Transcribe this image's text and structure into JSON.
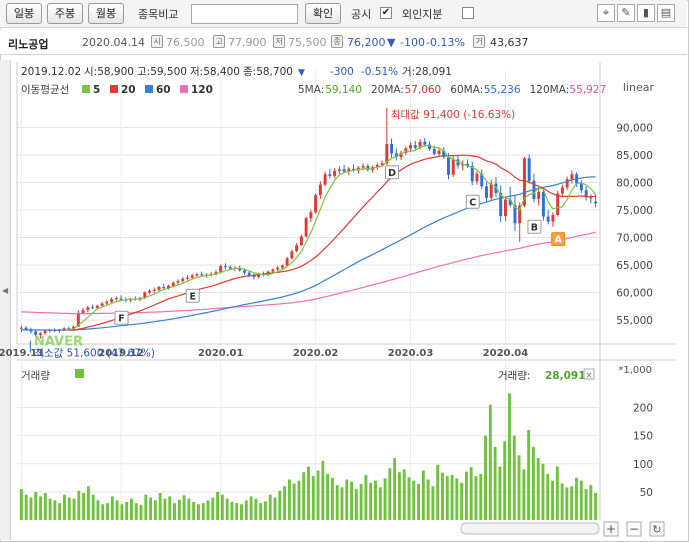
{
  "toolbar": {
    "tab_daily": "일봉",
    "tab_weekly": "주봉",
    "tab_monthly": "월봉",
    "compare_label": "종목비교",
    "compare_value": "",
    "confirm_label": "확인",
    "disclosure_label": "공시",
    "disclosure_checked": "✔",
    "foreign_label": "외인지분",
    "foreign_checked": ""
  },
  "info": {
    "name": "리노공업",
    "date": "2020.04.14",
    "open": "76,500",
    "high": "77,900",
    "low": "75,500",
    "close": "76,200",
    "change": "-100",
    "change_pct": "-0.13%",
    "volume": "43,637",
    "icons": {
      "open": "시",
      "high": "고",
      "low": "저",
      "close": "종",
      "volume": "거"
    }
  },
  "ohlc_readout": {
    "date": "2019.12.02",
    "text_open": "시:58,900",
    "text_high": "고:59,500",
    "text_low": "저:58,400",
    "text_close": "종:58,700",
    "change": "-300",
    "change_pct": "-0.51%",
    "volume": "거:28,091"
  },
  "legend": {
    "title": "이동평균선",
    "items": [
      {
        "label": "5",
        "color": "#7cc442"
      },
      {
        "label": "20",
        "color": "#e03a32"
      },
      {
        "label": "60",
        "color": "#3a7fd5"
      },
      {
        "label": "120",
        "color": "#f06eb5"
      }
    ],
    "ma_values": [
      {
        "label": "5MA:",
        "value": "59,140",
        "color": "#55a12a"
      },
      {
        "label": "20MA:",
        "value": "57,060",
        "color": "#d9302a"
      },
      {
        "label": "60MA:",
        "value": "55,236",
        "color": "#2b6fc5"
      },
      {
        "label": "120MA:",
        "value": "55,927",
        "color": "#e0509f"
      }
    ],
    "scale": "linear"
  },
  "annotations": {
    "max": "최대값 91,400 (-16.63%)",
    "min": "최소값 51,600 (47.67%)",
    "watermark": "NAVER",
    "markers": [
      "A",
      "B",
      "C",
      "D",
      "E",
      "F"
    ]
  },
  "volume_panel": {
    "title": "거래량",
    "readout_label": "거래량:",
    "readout_value": "28,091",
    "unit": "*1,000",
    "close_icon": "×"
  },
  "colors": {
    "up": "#e03a32",
    "down": "#2f6fdb",
    "volume": "#6dc43a",
    "ma5": "#7cc442",
    "ma20": "#e03a32",
    "ma60": "#3a7fd5",
    "ma120": "#f06eb5"
  },
  "chart_data": [
    {
      "type": "candlestick",
      "title": "리노공업",
      "x_tick_labels": [
        "2019.11",
        "2019.12",
        "2020.01",
        "2020.02",
        "2020.03",
        "2020.04"
      ],
      "y_tick_labels": [
        "90,000",
        "85,000",
        "80,000",
        "75,000",
        "70,000",
        "65,000",
        "60,000",
        "55,000"
      ],
      "ylim": [
        51000,
        95000
      ],
      "grid": true,
      "ohlc": [
        [
          53500,
          54000,
          52800,
          53600
        ],
        [
          53600,
          53900,
          53000,
          53200
        ],
        [
          53200,
          53600,
          52500,
          52900
        ],
        [
          52900,
          53300,
          52000,
          52300
        ],
        [
          52300,
          52800,
          51600,
          52600
        ],
        [
          52600,
          53200,
          52300,
          53000
        ],
        [
          53000,
          53400,
          52700,
          53200
        ],
        [
          53200,
          53500,
          52800,
          53000
        ],
        [
          53000,
          53400,
          52600,
          53300
        ],
        [
          53300,
          53700,
          53000,
          53500
        ],
        [
          53500,
          53800,
          53100,
          53300
        ],
        [
          53300,
          54000,
          53000,
          53800
        ],
        [
          53800,
          56800,
          53700,
          56300
        ],
        [
          56300,
          57200,
          56000,
          56800
        ],
        [
          56800,
          57600,
          56400,
          57300
        ],
        [
          57300,
          57800,
          57000,
          57200
        ],
        [
          57200,
          57800,
          56900,
          57600
        ],
        [
          57600,
          58300,
          57300,
          58000
        ],
        [
          58000,
          58600,
          57700,
          58300
        ],
        [
          58300,
          59100,
          58100,
          58800
        ],
        [
          58800,
          59300,
          58500,
          59000
        ],
        [
          58900,
          59500,
          58400,
          58700
        ],
        [
          58700,
          59100,
          58300,
          58600
        ],
        [
          58600,
          59000,
          58200,
          58900
        ],
        [
          58900,
          59300,
          58500,
          58700
        ],
        [
          58700,
          59200,
          58400,
          59000
        ],
        [
          59000,
          60200,
          58800,
          60000
        ],
        [
          60000,
          60600,
          59700,
          60300
        ],
        [
          60300,
          60900,
          59900,
          60500
        ],
        [
          60500,
          61200,
          60200,
          61000
        ],
        [
          61000,
          61600,
          60600,
          60800
        ],
        [
          60800,
          61400,
          60500,
          61200
        ],
        [
          61200,
          62000,
          61000,
          61800
        ],
        [
          61800,
          62400,
          61400,
          62100
        ],
        [
          62100,
          62800,
          61800,
          62500
        ],
        [
          62500,
          63200,
          62200,
          62700
        ],
        [
          62700,
          63400,
          62400,
          63100
        ],
        [
          63100,
          63600,
          62800,
          63300
        ],
        [
          63300,
          63800,
          62900,
          63100
        ],
        [
          63100,
          63500,
          62700,
          63200
        ],
        [
          63200,
          63700,
          62900,
          63400
        ],
        [
          63400,
          64100,
          63100,
          63700
        ],
        [
          63700,
          65100,
          63500,
          64800
        ],
        [
          64800,
          65300,
          64200,
          64600
        ],
        [
          64600,
          65000,
          64100,
          64300
        ],
        [
          64300,
          64800,
          63900,
          64500
        ],
        [
          64500,
          64900,
          63800,
          64000
        ],
        [
          64000,
          64400,
          63200,
          63600
        ],
        [
          63600,
          64000,
          62800,
          63100
        ],
        [
          63100,
          63500,
          62400,
          62800
        ],
        [
          62800,
          63600,
          62600,
          63400
        ],
        [
          63400,
          63800,
          62900,
          63200
        ],
        [
          63200,
          64000,
          63000,
          63800
        ],
        [
          63800,
          64400,
          63500,
          64200
        ],
        [
          64200,
          64900,
          63900,
          64500
        ],
        [
          64500,
          65100,
          64200,
          64900
        ],
        [
          64900,
          66500,
          64700,
          66200
        ],
        [
          66200,
          67800,
          66000,
          67500
        ],
        [
          67500,
          69000,
          67300,
          68600
        ],
        [
          68600,
          70500,
          68400,
          70200
        ],
        [
          70200,
          73800,
          70000,
          73500
        ],
        [
          73500,
          75000,
          72800,
          74600
        ],
        [
          74600,
          78000,
          74300,
          77700
        ],
        [
          77700,
          80200,
          77000,
          79600
        ],
        [
          79600,
          82000,
          79300,
          81500
        ],
        [
          81500,
          82500,
          80700,
          81200
        ],
        [
          81200,
          82600,
          80800,
          82100
        ],
        [
          82100,
          83000,
          81500,
          82400
        ],
        [
          82400,
          83200,
          81800,
          82000
        ],
        [
          82000,
          82800,
          81300,
          82500
        ],
        [
          82500,
          83300,
          81900,
          82200
        ],
        [
          82200,
          83000,
          81600,
          82700
        ],
        [
          82700,
          83500,
          82200,
          83000
        ],
        [
          83000,
          83400,
          82000,
          82300
        ],
        [
          82300,
          83100,
          81800,
          82800
        ],
        [
          82800,
          83600,
          82300,
          83200
        ],
        [
          83200,
          84000,
          82800,
          83500
        ],
        [
          83500,
          91400,
          83200,
          87000
        ],
        [
          87000,
          88000,
          84500,
          85300
        ],
        [
          85300,
          86200,
          84000,
          84600
        ],
        [
          84600,
          85800,
          84100,
          85400
        ],
        [
          85400,
          86600,
          85000,
          86200
        ],
        [
          86200,
          87300,
          85700,
          86800
        ],
        [
          86800,
          87600,
          85900,
          86300
        ],
        [
          86300,
          87900,
          86000,
          87400
        ],
        [
          87400,
          88100,
          86500,
          86900
        ],
        [
          86900,
          87500,
          85800,
          86100
        ],
        [
          86100,
          86700,
          84900,
          85200
        ],
        [
          85200,
          86200,
          84600,
          85800
        ],
        [
          85800,
          86400,
          84300,
          84600
        ],
        [
          84600,
          85300,
          80600,
          81400
        ],
        [
          81400,
          84800,
          81000,
          84200
        ],
        [
          84200,
          85000,
          82500,
          83100
        ],
        [
          83100,
          84000,
          82200,
          83400
        ],
        [
          83400,
          84200,
          82600,
          83000
        ],
        [
          83000,
          83800,
          79500,
          80200
        ],
        [
          80200,
          82000,
          79600,
          81600
        ],
        [
          81600,
          82400,
          78800,
          79300
        ],
        [
          79300,
          80100,
          76500,
          77200
        ],
        [
          77200,
          80500,
          76800,
          79800
        ],
        [
          79800,
          81000,
          77400,
          78100
        ],
        [
          78100,
          79500,
          72800,
          73900
        ],
        [
          73900,
          77500,
          73000,
          76900
        ],
        [
          76900,
          79200,
          75500,
          75900
        ],
        [
          75900,
          77800,
          71200,
          72600
        ],
        [
          72600,
          76400,
          69200,
          75800
        ],
        [
          75800,
          84700,
          75500,
          84400
        ],
        [
          84400,
          85100,
          79800,
          80300
        ],
        [
          80300,
          81600,
          76400,
          77000
        ],
        [
          77000,
          79000,
          75800,
          78300
        ],
        [
          78300,
          78700,
          73100,
          73800
        ],
        [
          73800,
          75000,
          72400,
          72900
        ],
        [
          72900,
          74600,
          72000,
          74100
        ],
        [
          74100,
          78500,
          73800,
          78000
        ],
        [
          78000,
          79600,
          77300,
          79100
        ],
        [
          79100,
          81100,
          78600,
          80600
        ],
        [
          80600,
          82200,
          79800,
          81500
        ],
        [
          81500,
          81900,
          79200,
          79800
        ],
        [
          79800,
          80400,
          78100,
          78600
        ],
        [
          78600,
          79300,
          76700,
          77300
        ],
        [
          77300,
          77900,
          76200,
          77100
        ],
        [
          76500,
          77900,
          75500,
          76200
        ]
      ],
      "ma5_end": 76400,
      "ma20_end": 77800,
      "ma60_end": 80500,
      "ma120_end": 70200,
      "max_marker": {
        "value": 91400,
        "label": "최대값 91,400 (-16.63%)"
      },
      "min_marker": {
        "value": 51600,
        "label": "최소값 51,600 (47.67%)"
      }
    },
    {
      "type": "bar",
      "title": "거래량",
      "unit": "*1,000",
      "y_tick_labels": [
        "200",
        "150",
        "100",
        "50"
      ],
      "ylim": [
        0,
        240
      ],
      "values": [
        55,
        45,
        40,
        50,
        42,
        48,
        38,
        35,
        30,
        45,
        40,
        38,
        52,
        48,
        60,
        45,
        35,
        28,
        30,
        42,
        35,
        28,
        32,
        38,
        30,
        27,
        45,
        40,
        35,
        48,
        38,
        42,
        30,
        36,
        44,
        38,
        32,
        28,
        30,
        35,
        40,
        50,
        45,
        38,
        32,
        30,
        28,
        35,
        42,
        38,
        30,
        33,
        45,
        40,
        52,
        60,
        72,
        65,
        70,
        85,
        95,
        78,
        88,
        105,
        82,
        75,
        62,
        58,
        72,
        68,
        55,
        64,
        80,
        66,
        70,
        58,
        74,
        92,
        110,
        85,
        90,
        76,
        70,
        64,
        88,
        72,
        60,
        98,
        84,
        78,
        80,
        74,
        66,
        86,
        94,
        78,
        82,
        150,
        205,
        130,
        95,
        140,
        225,
        150,
        115,
        90,
        160,
        130,
        110,
        100,
        82,
        70,
        95,
        65,
        58,
        60,
        75,
        70,
        55,
        62,
        48
      ]
    }
  ]
}
